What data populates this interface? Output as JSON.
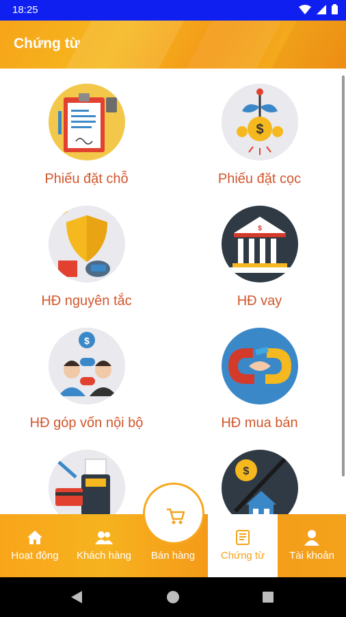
{
  "status_bar": {
    "time": "18:25"
  },
  "app_bar": {
    "title": "Chứng từ"
  },
  "grid": [
    {
      "label": "Phiếu đặt chỗ",
      "icon": "clipboard-icon"
    },
    {
      "label": "Phiếu đặt cọc",
      "icon": "money-growth-icon"
    },
    {
      "label": "HĐ nguyên tắc",
      "icon": "shield-icon"
    },
    {
      "label": "HĐ vay",
      "icon": "bank-icon"
    },
    {
      "label": "HĐ góp vốn nội bộ",
      "icon": "partners-icon"
    },
    {
      "label": "HĐ mua bán",
      "icon": "handshake-icon"
    },
    {
      "label": "",
      "icon": "pos-terminal-icon"
    },
    {
      "label": "",
      "icon": "house-growth-icon"
    }
  ],
  "bottom_nav": {
    "items": [
      {
        "label": "Hoạt động",
        "icon": "home-icon"
      },
      {
        "label": "Khách hàng",
        "icon": "customers-icon"
      },
      {
        "label": "Bán hàng",
        "icon": "cart-icon"
      },
      {
        "label": "Chứng từ",
        "icon": "document-icon",
        "active": true
      },
      {
        "label": "Tài khoản",
        "icon": "account-icon"
      }
    ]
  },
  "colors": {
    "accent": "#f4a21b",
    "label": "#d2552b",
    "status_bar": "#0e1ff0"
  }
}
